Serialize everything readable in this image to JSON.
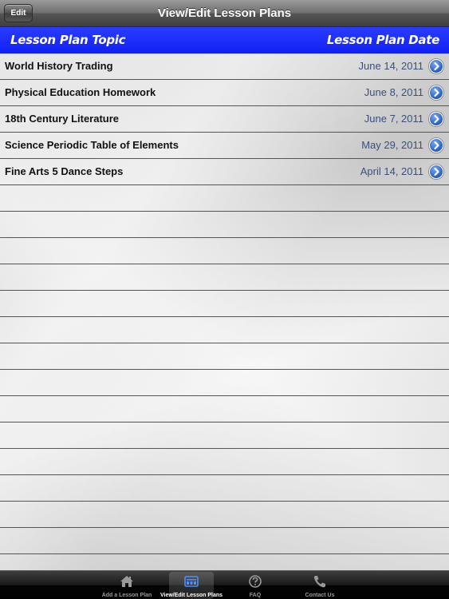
{
  "navbar": {
    "title": "View/Edit Lesson Plans",
    "edit_label": "Edit"
  },
  "header": {
    "topic_label": "Lesson Plan Topic",
    "date_label": "Lesson Plan Date"
  },
  "lessons": [
    {
      "title": "World History Trading",
      "date": "June 14, 2011"
    },
    {
      "title": "Physical Education Homework",
      "date": "June 8, 2011"
    },
    {
      "title": "18th Century Literature",
      "date": "June 7, 2011"
    },
    {
      "title": "Science Periodic Table of Elements",
      "date": "May 29, 2011"
    },
    {
      "title": "Fine Arts 5 Dance Steps",
      "date": "April 14, 2011"
    }
  ],
  "tabbar": {
    "tabs": [
      {
        "label": "Add a Lesson Plan",
        "icon": "house-icon"
      },
      {
        "label": "View/Edit Lesson Plans",
        "icon": "list-icon",
        "active": true
      },
      {
        "label": "FAQ",
        "icon": "question-icon"
      },
      {
        "label": "Contact Us",
        "icon": "phone-icon"
      }
    ]
  },
  "colors": {
    "header_band": "#1a2cff",
    "disclosure": "#2a62c9",
    "date_text": "#3a4f7e"
  }
}
